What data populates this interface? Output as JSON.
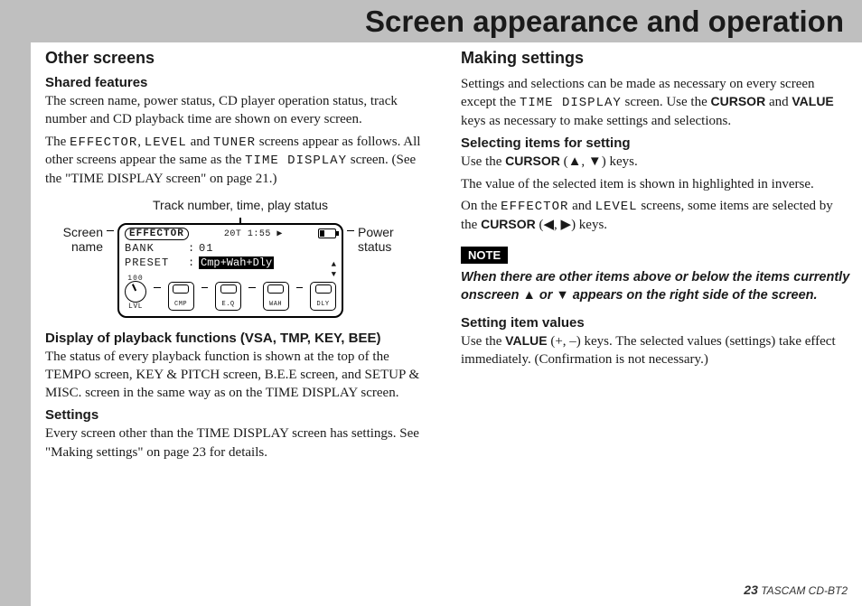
{
  "header": {
    "title": "Screen appearance and operation"
  },
  "left": {
    "h2": "Other screens",
    "shared": {
      "h3": "Shared features",
      "p1": "The screen name, power status, CD player operation status, track number and CD playback time are shown on every screen.",
      "p2a": "The ",
      "eff": "EFFECTOR",
      "p2b": ", ",
      "lvl": "LEVEL",
      "p2c": " and ",
      "tun": "TUNER",
      "p2d": " screens appear as follows. All other screens appear the same as the ",
      "td": "TIME DISPLAY",
      "p2e": " screen. (See the \"TIME DISPLAY screen\" on page 21.)"
    },
    "diagram": {
      "topLabel": "Track number, time, play status",
      "leftLabel": "Screen name",
      "rightLabel": "Power status",
      "lcd": {
        "pill": "EFFECTOR",
        "topTime": "20T 1:55 ▶",
        "bank_k": "BANK",
        "bank_v": "01",
        "preset_k": "PRESET",
        "preset_v": "Cmp+Wah+Dly",
        "knob100": "100",
        "knobLbl": "LVL",
        "p1": "CMP",
        "p2": "E.Q",
        "p3": "WAH",
        "p4": "DLY"
      }
    },
    "playback": {
      "h3": "Display of playback functions (VSA, TMP, KEY, BEE)",
      "p": "The status of every playback function is shown at the top of the TEMPO screen, KEY & PITCH screen, B.E.E screen, and SETUP & MISC. screen in the same way as on the TIME DISPLAY screen."
    },
    "settings": {
      "h3": "Settings",
      "p": "Every screen other than the TIME DISPLAY screen has settings. See \"Making settings\" on page 23 for details."
    }
  },
  "right": {
    "h2": "Making settings",
    "intro_a": "Settings and selections can be made as necessary on every screen except the ",
    "intro_td": "TIME DISPLAY",
    "intro_b": " screen. Use the ",
    "intro_cursor": "CURSOR",
    "intro_c": " and ",
    "intro_value": "VALUE",
    "intro_d": " keys as necessary to make settings and selections.",
    "sel": {
      "h3": "Selecting items for setting",
      "p1a": "Use the ",
      "cursor": "CURSOR",
      "p1b": " (▲, ▼) keys.",
      "p2": "The value of the selected item is shown in highlighted in inverse.",
      "p3a": "On the ",
      "eff": "EFFECTOR",
      "p3b": " and ",
      "lvl": "LEVEL",
      "p3c": " screens, some items are selected by the ",
      "cursor2": "CURSOR",
      "p3d": " (◀, ▶) keys."
    },
    "note": {
      "badge": "NOTE",
      "text": "When there are other items above or below the items currently onscreen ▲ or ▼ appears on the right side of the screen."
    },
    "setvals": {
      "h3": "Setting item values",
      "p_a": "Use the ",
      "value": "VALUE",
      "p_b": " (+, –) keys. The selected values (settings) take effect immediately. (Confirmation is not necessary.)"
    }
  },
  "footer": {
    "page": "23",
    "model": "TASCAM  CD-BT2"
  }
}
